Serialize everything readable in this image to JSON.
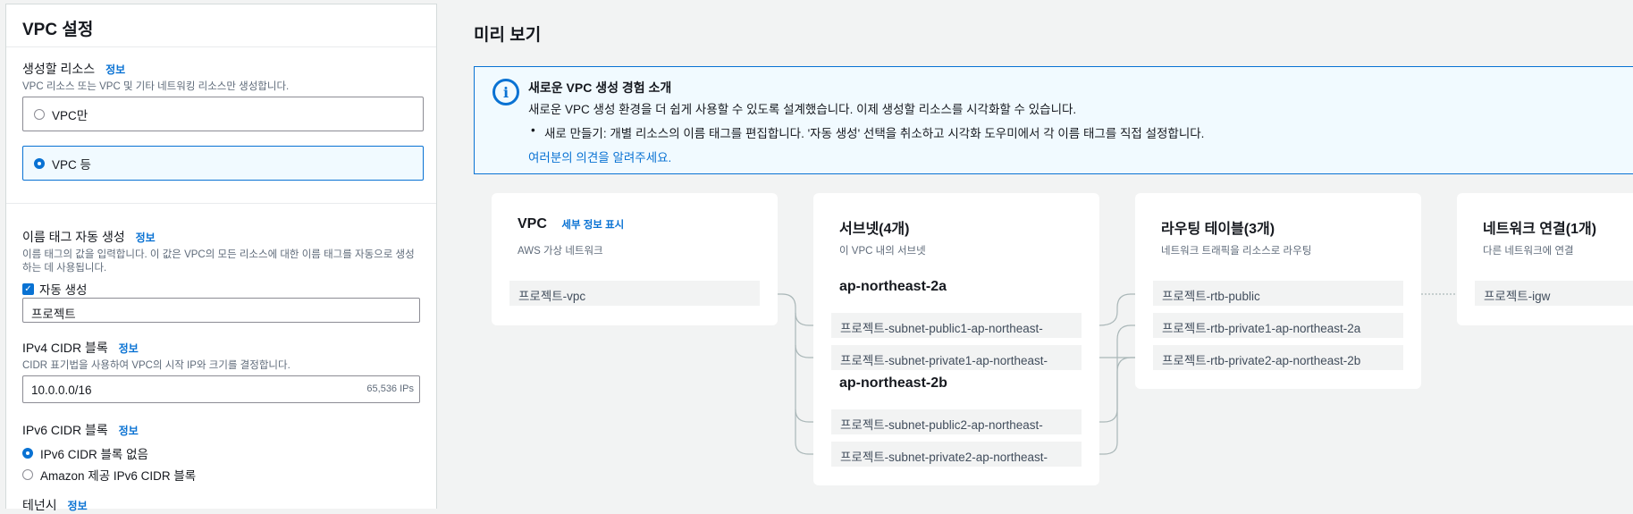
{
  "settings": {
    "title": "VPC 설정",
    "resources_label": "생성할 리소스",
    "info": "정보",
    "resources_desc": "VPC 리소스 또는 VPC 및 기타 네트워킹 리소스만 생성합니다.",
    "option_vpc_only": "VPC만",
    "option_vpc_more": "VPC 등",
    "name_tag_label": "이름 태그 자동 생성",
    "name_tag_desc": "이름 태그의 값을 입력합니다. 이 값은 VPC의 모든 리소스에 대한 이름 태그를 자동으로 생성하는 데 사용됩니다.",
    "auto_generate_label": "자동 생성",
    "name_tag_value": "프로젝트",
    "ipv4_label": "IPv4 CIDR 블록",
    "ipv4_desc": "CIDR 표기법을 사용하여 VPC의 시작 IP와 크기를 결정합니다.",
    "ipv4_value": "10.0.0.0/16",
    "ipv4_suffix": "65,536 IPs",
    "ipv6_label": "IPv6 CIDR 블록",
    "ipv6_none": "IPv6 CIDR 블록 없음",
    "ipv6_amazon": "Amazon 제공 IPv6 CIDR 블록",
    "tenancy_label": "테넌시"
  },
  "preview": {
    "title": "미리 보기",
    "alert": {
      "title": "새로운 VPC 생성 경험 소개",
      "body": "새로운 VPC 생성 환경을 더 쉽게 사용할 수 있도록 설계했습니다. 이제 생성할 리소스를 시각화할 수 있습니다.",
      "bullet": "새로 만들기: 개별 리소스의 이름 태그를 편집합니다. '자동 생성' 선택을 취소하고 시각화 도우미에서 각 이름 태그를 직접 설정합니다.",
      "link": "여러분의 의견을 알려주세요."
    },
    "vpc": {
      "title": "VPC",
      "details_link": "세부 정보 표시",
      "subtitle": "AWS 가상 네트워크",
      "resource": "프로젝트-vpc"
    },
    "subnets": {
      "title": "서브넷(4개)",
      "subtitle": "이 VPC 내의 서브넷",
      "az1": "ap-northeast-2a",
      "az2": "ap-northeast-2b",
      "items": [
        "프로젝트-subnet-public1-ap-northeast-",
        "프로젝트-subnet-private1-ap-northeast-",
        "프로젝트-subnet-public2-ap-northeast-",
        "프로젝트-subnet-private2-ap-northeast-"
      ]
    },
    "route_tables": {
      "title": "라우팅 테이블(3개)",
      "subtitle": "네트워크 트래픽을 리소스로 라우팅",
      "items": [
        "프로젝트-rtb-public",
        "프로젝트-rtb-private1-ap-northeast-2a",
        "프로젝트-rtb-private2-ap-northeast-2b"
      ]
    },
    "network": {
      "title": "네트워크 연결(1개)",
      "subtitle": "다른 네트워크에 연결",
      "resource": "프로젝트-igw"
    }
  },
  "colors": {
    "accent": "#0972d3",
    "alert_bg": "#f1faff",
    "connector": "#aab7b8"
  }
}
